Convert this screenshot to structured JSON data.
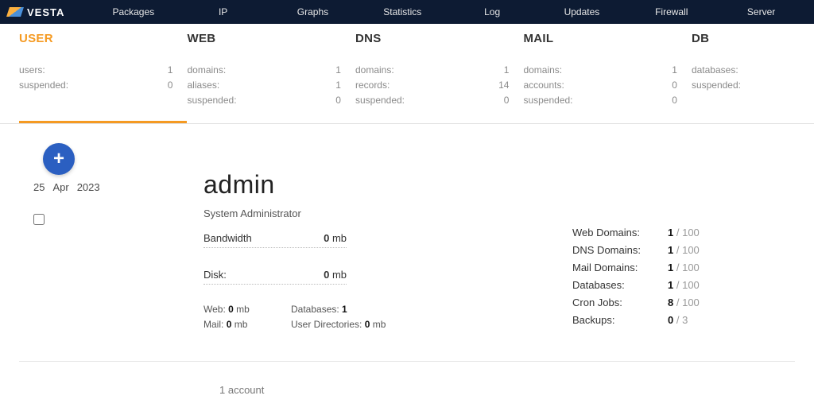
{
  "brand": "VESTA",
  "nav": [
    "Packages",
    "IP",
    "Graphs",
    "Statistics",
    "Log",
    "Updates",
    "Firewall",
    "Server"
  ],
  "tabs": {
    "user": {
      "label": "USER",
      "rows": [
        {
          "l": "users:",
          "v": "1"
        },
        {
          "l": "suspended:",
          "v": "0"
        }
      ]
    },
    "web": {
      "label": "WEB",
      "rows": [
        {
          "l": "domains:",
          "v": "1"
        },
        {
          "l": "aliases:",
          "v": "1"
        },
        {
          "l": "suspended:",
          "v": "0"
        }
      ]
    },
    "dns": {
      "label": "DNS",
      "rows": [
        {
          "l": "domains:",
          "v": "1"
        },
        {
          "l": "records:",
          "v": "14"
        },
        {
          "l": "suspended:",
          "v": "0"
        }
      ]
    },
    "mail": {
      "label": "MAIL",
      "rows": [
        {
          "l": "domains:",
          "v": "1"
        },
        {
          "l": "accounts:",
          "v": "0"
        },
        {
          "l": "suspended:",
          "v": "0"
        }
      ]
    },
    "db": {
      "label": "DB",
      "rows": [
        {
          "l": "databases:",
          "v": ""
        },
        {
          "l": "suspended:",
          "v": ""
        }
      ]
    }
  },
  "date": {
    "day": "25",
    "month": "Apr",
    "year": "2023"
  },
  "account": {
    "name": "admin",
    "role": "System Administrator",
    "bandwidth": {
      "label": "Bandwidth",
      "value": "0",
      "unit": "mb"
    },
    "disk": {
      "label": "Disk:",
      "value": "0",
      "unit": "mb"
    },
    "mini": {
      "web": {
        "label": "Web:",
        "value": "0",
        "unit": "mb"
      },
      "mail": {
        "label": "Mail:",
        "value": "0",
        "unit": "mb"
      },
      "databases": {
        "label": "Databases:",
        "value": "1"
      },
      "userdirs": {
        "label": "User Directories:",
        "value": "0",
        "unit": "mb"
      }
    },
    "limits": [
      {
        "label": "Web Domains:",
        "value": "1",
        "cap": "100"
      },
      {
        "label": "DNS Domains:",
        "value": "1",
        "cap": "100"
      },
      {
        "label": "Mail Domains:",
        "value": "1",
        "cap": "100"
      },
      {
        "label": "Databases:",
        "value": "1",
        "cap": "100"
      },
      {
        "label": "Cron Jobs:",
        "value": "8",
        "cap": "100"
      },
      {
        "label": "Backups:",
        "value": "0",
        "cap": "3"
      }
    ]
  },
  "footer": "1 account"
}
